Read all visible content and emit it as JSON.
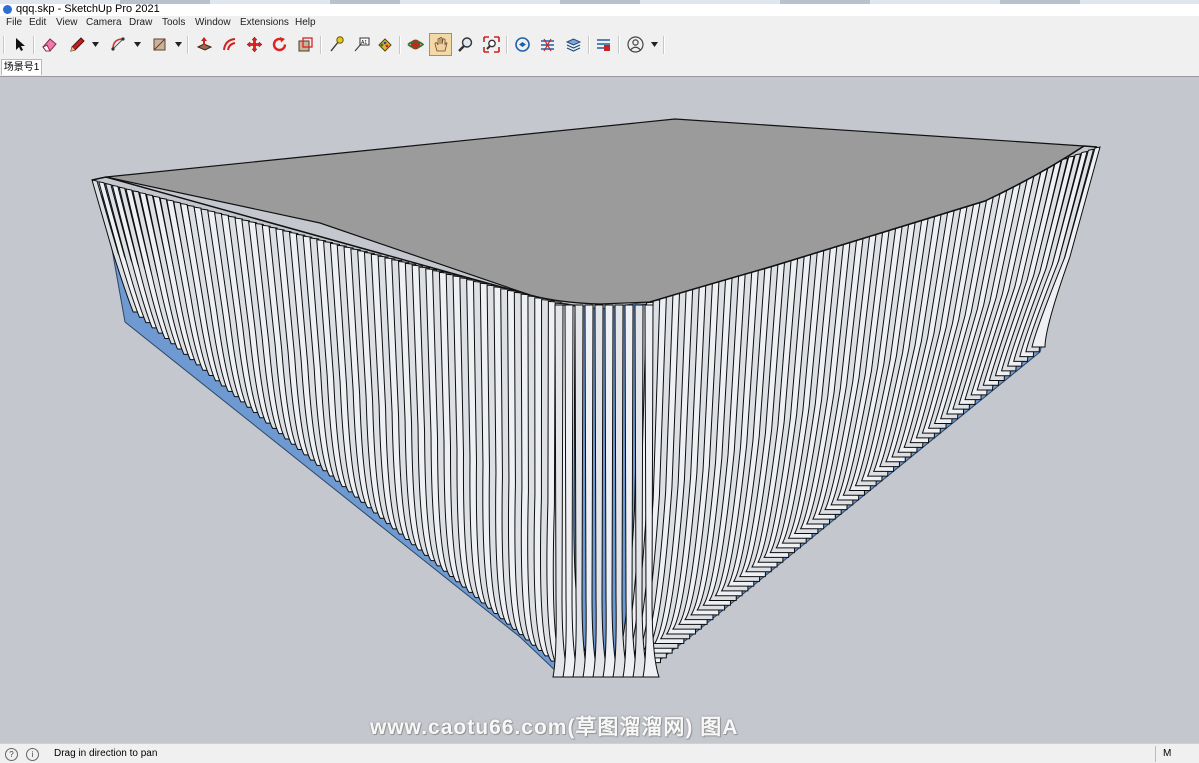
{
  "window": {
    "title": "qqq.skp - SketchUp Pro 2021"
  },
  "menu": [
    "File",
    "Edit",
    "View",
    "Camera",
    "Draw",
    "Tools",
    "Window",
    "Extensions",
    "Help"
  ],
  "toolbar": {
    "tools": [
      {
        "id": "select",
        "icon": "select-arrow-icon"
      },
      {
        "id": "eraser",
        "icon": "eraser-icon"
      },
      {
        "id": "line",
        "icon": "pencil-icon",
        "dropdown": true
      },
      {
        "id": "arc",
        "icon": "arc-icon",
        "dropdown": true
      },
      {
        "id": "rectangle",
        "icon": "rectangle-icon",
        "dropdown": true
      },
      {
        "id": "pushpull",
        "icon": "push-pull-icon"
      },
      {
        "id": "offset",
        "icon": "offset-icon"
      },
      {
        "id": "move",
        "icon": "move-icon"
      },
      {
        "id": "rotate",
        "icon": "rotate-icon"
      },
      {
        "id": "scale",
        "icon": "scale-icon"
      },
      {
        "id": "tape",
        "icon": "tape-measure-icon"
      },
      {
        "id": "text",
        "icon": "text-icon"
      },
      {
        "id": "paint",
        "icon": "paint-bucket-icon"
      },
      {
        "id": "orbit",
        "icon": "orbit-icon"
      },
      {
        "id": "pan",
        "icon": "pan-hand-icon",
        "active": true
      },
      {
        "id": "zoom",
        "icon": "zoom-icon"
      },
      {
        "id": "zoom-extents",
        "icon": "zoom-extents-icon"
      },
      {
        "id": "warehouse",
        "icon": "3d-warehouse-icon"
      },
      {
        "id": "ext-warehouse",
        "icon": "extension-warehouse-icon"
      },
      {
        "id": "layout",
        "icon": "send-to-layout-icon"
      },
      {
        "id": "ext-manager",
        "icon": "extension-manager-icon"
      },
      {
        "id": "account",
        "icon": "user-account-icon",
        "dropdown": true
      }
    ]
  },
  "scene_tab": {
    "label": "场景号1"
  },
  "watermark": "www.caotu66.com(草图溜溜网) 图A",
  "status": {
    "hint": "Drag in direction to pan",
    "measurements_label": "M"
  },
  "colors": {
    "viewport_bg": "#c4c7cd",
    "glass_blue": "#6f99d1",
    "roof_gray": "#9b9b9b",
    "fin_white": "#eef0f3",
    "active_tool": "#f3d9a6"
  }
}
